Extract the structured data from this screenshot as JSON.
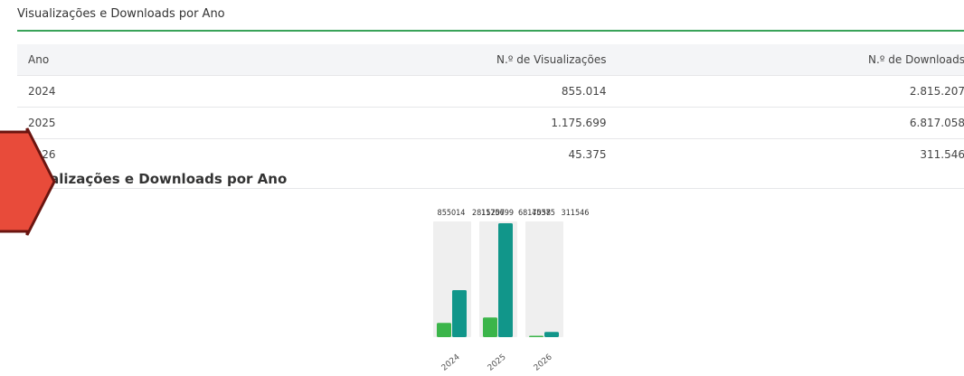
{
  "section": {
    "title": "Visualizações e Downloads por Ano"
  },
  "table": {
    "headers": [
      "Ano",
      "N.º de Visualizações",
      "N.º de Downloads"
    ],
    "rows": [
      [
        "2024",
        "855.014",
        "2.815.207"
      ],
      [
        "2025",
        "1.175.699",
        "6.817.058"
      ],
      [
        "2026",
        "45.375",
        "311.546"
      ]
    ]
  },
  "chart_section": {
    "title": "Visualizações e Downloads por Ano"
  },
  "colors": {
    "accent_green": "#3aa35a",
    "views_bar": "#3bb54a",
    "downloads_bar": "#11968a",
    "arrow_fill": "#e84b3a",
    "arrow_stroke": "#6b1510"
  },
  "chart_data": {
    "type": "bar",
    "categories": [
      "2024",
      "2025",
      "2026"
    ],
    "series": [
      {
        "name": "",
        "values": [
          855014,
          1175699,
          45375
        ]
      },
      {
        "name": "",
        "values": [
          2815207,
          6817058,
          311546
        ]
      }
    ],
    "title": "Visualizações e Downloads por Ano",
    "xlabel": "",
    "ylabel": "",
    "ylim": [
      0,
      6817058
    ],
    "grid": false,
    "legend": "none"
  }
}
